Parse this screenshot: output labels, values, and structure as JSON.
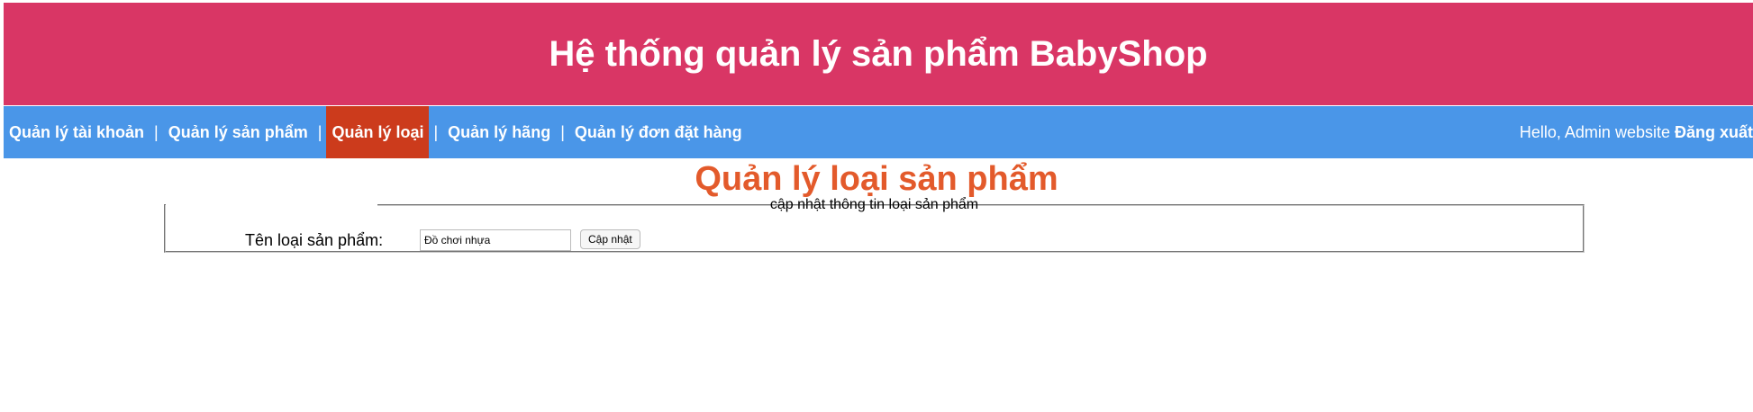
{
  "header": {
    "title": "Hệ thống quản lý sản phẩm BabyShop"
  },
  "nav": {
    "items": [
      {
        "label": "Quản lý tài khoản",
        "active": false
      },
      {
        "label": "Quản lý sản phẩm",
        "active": false
      },
      {
        "label": "Quản lý loại",
        "active": true
      },
      {
        "label": "Quản lý hãng",
        "active": false
      },
      {
        "label": "Quản lý đơn đặt hàng",
        "active": false
      }
    ],
    "separator": "|",
    "greeting": "Hello, Admin website",
    "logout_label": "Đăng xuất"
  },
  "main": {
    "title": "Quản lý loại sản phẩm",
    "form": {
      "legend": "cập nhật thông tin loại sản phẩm",
      "name_label": "Tên loại sản phẩm:",
      "name_value": "Đồ chơi nhựa",
      "submit_label": "Cập nhật"
    }
  },
  "colors": {
    "header_bg": "#d93665",
    "nav_bg": "#4a96e8",
    "nav_active_bg": "#cc3b1c",
    "title_color": "#e35a2b"
  }
}
